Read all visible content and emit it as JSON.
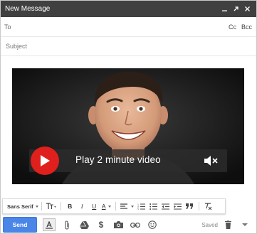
{
  "window": {
    "title": "New Message",
    "controls": [
      "minimize-icon",
      "pop-out-icon",
      "close-icon"
    ]
  },
  "recipients": {
    "to_label": "To",
    "cc_label": "Cc",
    "bcc_label": "Bcc",
    "subject_placeholder": "Subject"
  },
  "video": {
    "label": "Play 2 minute video",
    "play_icon": "play-icon",
    "mute_icon": "volume-muted-icon",
    "accent_color": "#e0201d"
  },
  "format_toolbar": {
    "font": "Sans Serif",
    "size_icon": "font-size-icon",
    "bold": "B",
    "italic": "I",
    "underline": "U",
    "text_color": "A",
    "items": [
      "align-icon",
      "numbered-list-icon",
      "bulleted-list-icon",
      "indent-less-icon",
      "indent-more-icon",
      "quote-icon",
      "remove-formatting-icon"
    ]
  },
  "actions": {
    "send_label": "Send",
    "saved_label": "Saved",
    "send_color": "#4a86e8",
    "icons": [
      "formatting-options-icon",
      "attach-icon",
      "drive-icon",
      "money-icon",
      "photo-icon",
      "link-icon",
      "emoji-icon",
      "trash-icon",
      "more-options-icon"
    ]
  }
}
